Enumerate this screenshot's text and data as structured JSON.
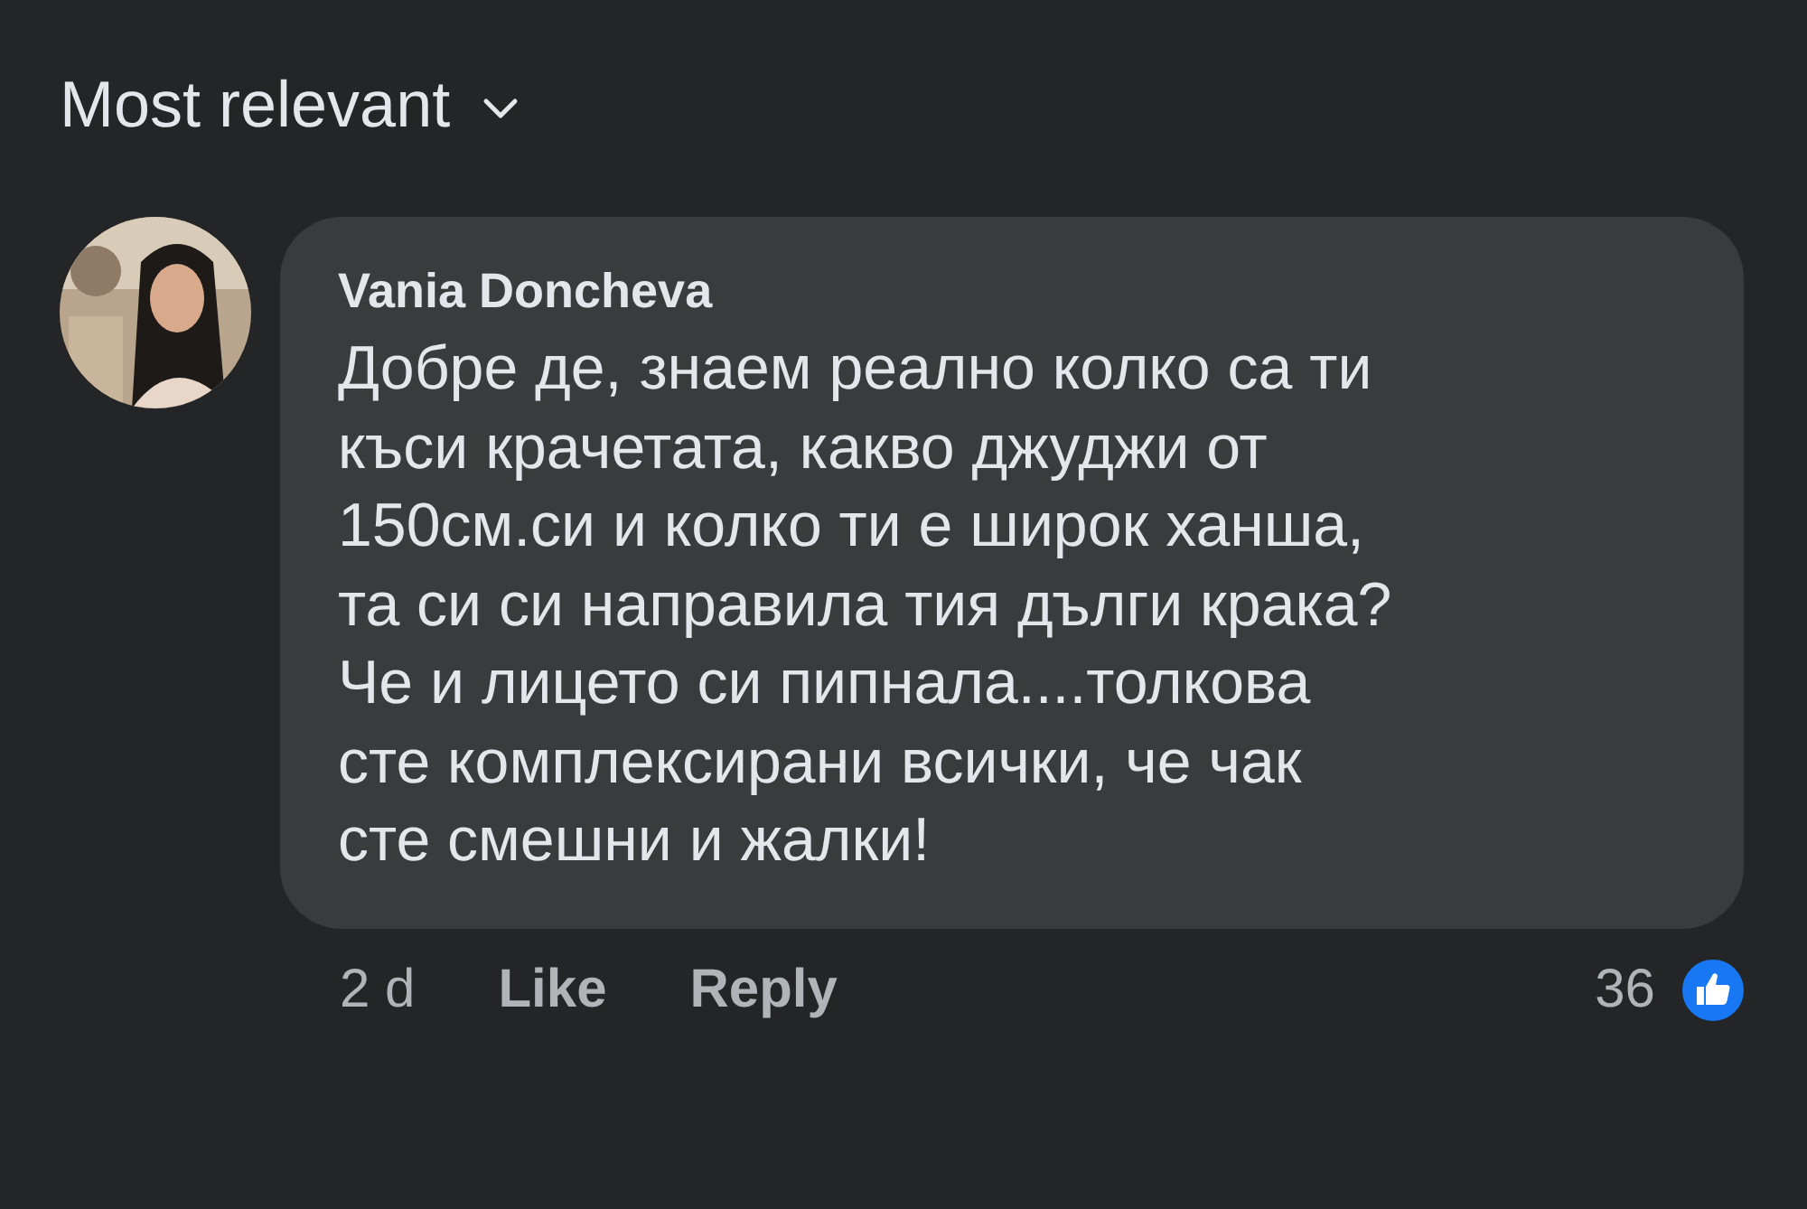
{
  "sort": {
    "label": "Most relevant"
  },
  "comment": {
    "author": "Vania Doncheva",
    "text": "Добре де, знаем реално колко са ти\nкъси крачетата, какво джуджи от\n150см.си и колко ти е широк ханша,\nта си си направила тия дълги крака?\nЧе и лицето си пипнала....толкова\nсте комплексирани всички, че чак\nсте смешни и жалки!",
    "time": "2 d",
    "like": "Like",
    "reply": "Reply",
    "reactions": "36"
  }
}
